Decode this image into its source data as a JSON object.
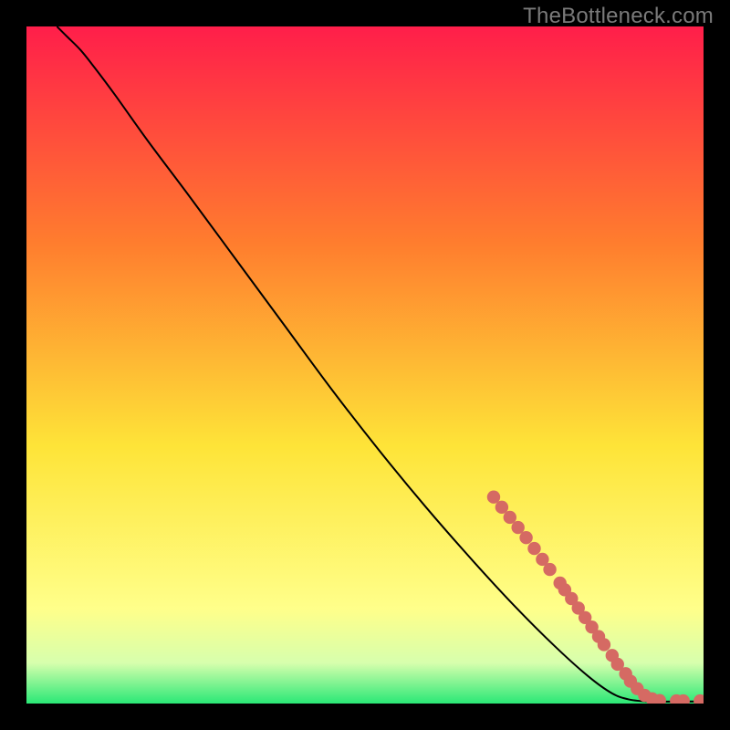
{
  "attribution": "TheBottleneck.com",
  "colors": {
    "gradient_top": "#ff1e4a",
    "gradient_mid_upper": "#ff7d2e",
    "gradient_mid": "#fee438",
    "gradient_lower_yellow": "#ffff8a",
    "gradient_near_bottom": "#d7ffad",
    "gradient_bottom": "#2ae876",
    "curve_stroke": "#000000",
    "marker_fill": "#d56a63",
    "frame_bg": "#000000"
  },
  "chart_data": {
    "type": "line",
    "title": "",
    "xlabel": "",
    "ylabel": "",
    "x_range": [
      0,
      100
    ],
    "y_range": [
      0,
      100
    ],
    "curve": {
      "comment": "Monotone decreasing bottleneck curve; starts at top-left, ends along bottom edge near right side.",
      "points": [
        {
          "x": 4.5,
          "y": 100.0
        },
        {
          "x": 6.0,
          "y": 98.5
        },
        {
          "x": 8.0,
          "y": 96.5
        },
        {
          "x": 10.0,
          "y": 94.0
        },
        {
          "x": 13.0,
          "y": 90.0
        },
        {
          "x": 18.0,
          "y": 83.0
        },
        {
          "x": 24.0,
          "y": 75.0
        },
        {
          "x": 31.0,
          "y": 65.5
        },
        {
          "x": 38.0,
          "y": 56.0
        },
        {
          "x": 45.0,
          "y": 46.5
        },
        {
          "x": 52.0,
          "y": 37.5
        },
        {
          "x": 59.0,
          "y": 29.0
        },
        {
          "x": 66.0,
          "y": 21.0
        },
        {
          "x": 72.0,
          "y": 14.5
        },
        {
          "x": 78.0,
          "y": 8.5
        },
        {
          "x": 83.0,
          "y": 4.0
        },
        {
          "x": 86.5,
          "y": 1.5
        },
        {
          "x": 89.0,
          "y": 0.6
        },
        {
          "x": 92.0,
          "y": 0.3
        },
        {
          "x": 96.0,
          "y": 0.3
        },
        {
          "x": 100.0,
          "y": 0.3
        }
      ]
    },
    "markers": {
      "comment": "Salmon round markers clustered on the lower-right portion of the curve.",
      "points": [
        {
          "x": 69.0,
          "y": 30.5
        },
        {
          "x": 70.2,
          "y": 29.0
        },
        {
          "x": 71.4,
          "y": 27.5
        },
        {
          "x": 72.6,
          "y": 26.0
        },
        {
          "x": 73.8,
          "y": 24.5
        },
        {
          "x": 75.0,
          "y": 22.9
        },
        {
          "x": 76.2,
          "y": 21.3
        },
        {
          "x": 77.3,
          "y": 19.8
        },
        {
          "x": 78.8,
          "y": 17.8
        },
        {
          "x": 79.5,
          "y": 16.8
        },
        {
          "x": 80.5,
          "y": 15.5
        },
        {
          "x": 81.5,
          "y": 14.1
        },
        {
          "x": 82.5,
          "y": 12.7
        },
        {
          "x": 83.5,
          "y": 11.3
        },
        {
          "x": 84.5,
          "y": 9.9
        },
        {
          "x": 85.3,
          "y": 8.7
        },
        {
          "x": 86.5,
          "y": 7.1
        },
        {
          "x": 87.3,
          "y": 5.8
        },
        {
          "x": 88.5,
          "y": 4.4
        },
        {
          "x": 89.2,
          "y": 3.3
        },
        {
          "x": 90.2,
          "y": 2.2
        },
        {
          "x": 91.3,
          "y": 1.2
        },
        {
          "x": 92.4,
          "y": 0.7
        },
        {
          "x": 93.5,
          "y": 0.45
        },
        {
          "x": 96.0,
          "y": 0.4
        },
        {
          "x": 97.0,
          "y": 0.4
        },
        {
          "x": 99.5,
          "y": 0.4
        }
      ]
    }
  }
}
